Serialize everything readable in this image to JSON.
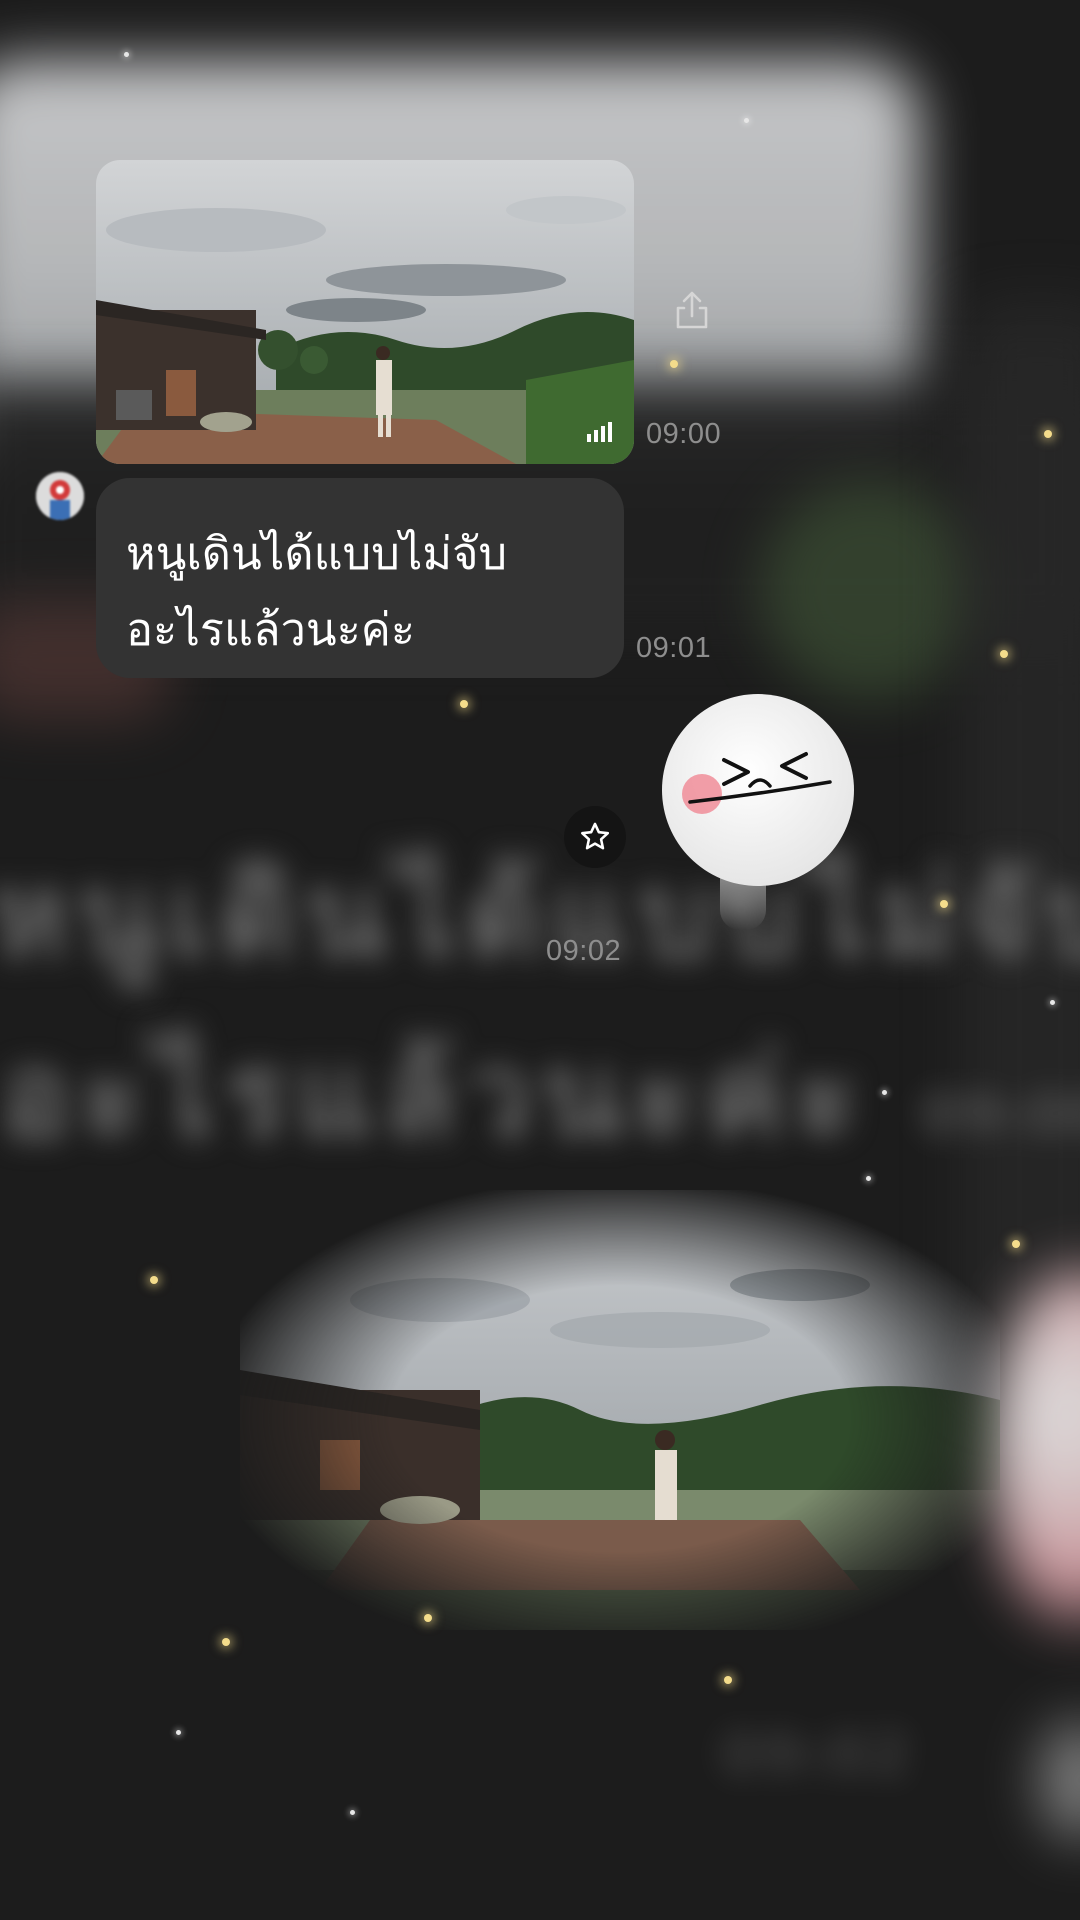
{
  "chat": {
    "messages": [
      {
        "type": "video",
        "time": "09:00",
        "signal_icon": "signal-bars-icon"
      },
      {
        "type": "text",
        "lines": [
          "หนูเดินได้แบบไม่จับ",
          "อะไรแล้วนะค่ะ"
        ],
        "time": "09:01"
      },
      {
        "type": "sticker",
        "sticker_name": "moon-laughing-sticker",
        "time": "09:02"
      }
    ],
    "share_icon": "share-icon",
    "star_icon": "star-icon"
  },
  "colors": {
    "background": "#1c1c1c",
    "bubble": "#333333",
    "timestamp": "#8e8e8e",
    "sparkle": "#f4dc8b"
  }
}
